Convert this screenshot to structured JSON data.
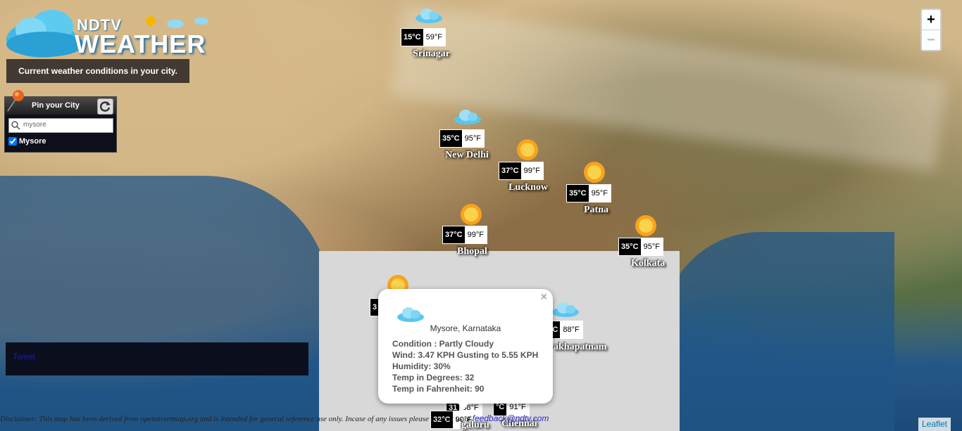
{
  "logo": {
    "ndtv": "NDTV",
    "weather": "WEATHER"
  },
  "tagline": "Current weather conditions in your city.",
  "pin_panel": {
    "title": "Pin your City",
    "search_value": "mysore",
    "checked_city": "Mysore"
  },
  "tweet": "Tweet",
  "zoom": {
    "in": "+",
    "out": "−"
  },
  "attribution": "Leaflet",
  "cities": [
    {
      "name": "Srinagar",
      "c": "15°C",
      "f": "59°F",
      "icon": "cloud-icon"
    },
    {
      "name": "New Delhi",
      "c": "35°C",
      "f": "95°F",
      "icon": "cloud-icon"
    },
    {
      "name": "Lucknow",
      "c": "37°C",
      "f": "99°F",
      "icon": "sun-icon"
    },
    {
      "name": "Patna",
      "c": "35°C",
      "f": "95°F",
      "icon": "sun-icon"
    },
    {
      "name": "Bhopal",
      "c": "37°C",
      "f": "99°F",
      "icon": "sun-icon"
    },
    {
      "name": "Kolkata",
      "c": "35°C",
      "f": "95°F",
      "icon": "sun-icon"
    },
    {
      "name": "Visakhapatnam",
      "c": "°C",
      "f": "88°F",
      "icon": "cloud-icon"
    },
    {
      "name": "Bengaluru",
      "c": "32°C",
      "f": "90°F",
      "icon": "cloud-icon"
    },
    {
      "name": "Chennai",
      "c": "°C",
      "f": "91°F",
      "icon": "cloud-icon"
    }
  ],
  "hidden_marks": {
    "mumbai_c": "3",
    "hyd_c": "31",
    "hyd_f": "88°F",
    "partial_visakha": "akhapatnam",
    "partial_blr": "galuru"
  },
  "popup": {
    "close": "×",
    "title": "Mysore, Karnataka",
    "condition": "Condition : Partly Cloudy",
    "wind": "Wind: 3.47 KPH Gusting to 5.55 KPH",
    "humidity": "Humidity: 30%",
    "temp_c": "Temp in Degrees: 32",
    "temp_f": "Temp in Fahrenheit: 90"
  },
  "disclaimer": {
    "text": "Disclaimer: This map has been derived from openstreetmap.org and is intended for general reference use only. Incase of any issues please contact us at",
    "email": "feedback@ndtv.com"
  }
}
